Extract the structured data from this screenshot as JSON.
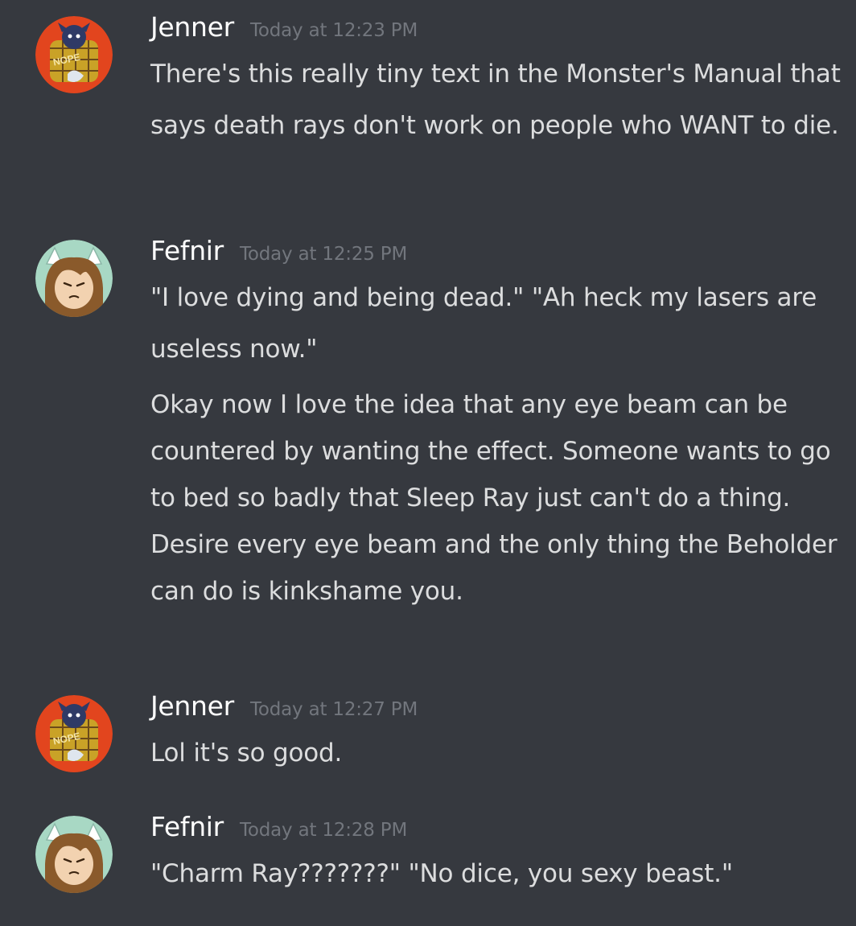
{
  "messages": [
    {
      "author": "Jenner",
      "timestamp": "Today at 12:23 PM",
      "avatar_icon": "nope-jester-avatar",
      "paragraphs": [
        "There's this really tiny text in the Monster's Manual that says death rays don't work on people who WANT to die."
      ]
    },
    {
      "author": "Fefnir",
      "timestamp": "Today at 12:25 PM",
      "avatar_icon": "horned-character-avatar",
      "paragraphs": [
        "\"I love dying and being dead.\" \"Ah heck my lasers are useless now.\"",
        "Okay now I love the idea that any eye beam can be countered by wanting the effect. Someone wants to go to bed so badly that Sleep Ray just can't do a thing.",
        "Desire every eye beam and the only thing the Beholder can do is kinkshame you."
      ]
    },
    {
      "author": "Jenner",
      "timestamp": "Today at 12:27 PM",
      "avatar_icon": "nope-jester-avatar",
      "paragraphs": [
        "Lol it's so good."
      ]
    },
    {
      "author": "Fefnir",
      "timestamp": "Today at 12:28 PM",
      "avatar_icon": "horned-character-avatar",
      "paragraphs": [
        "\"Charm Ray???????\" \"No dice, you sexy beast.\""
      ]
    }
  ],
  "avatar_badge_text": "NOPE",
  "colors": {
    "background": "#36393f",
    "author": "#ffffff",
    "timestamp": "#72767d",
    "message_text": "#dcddde"
  }
}
